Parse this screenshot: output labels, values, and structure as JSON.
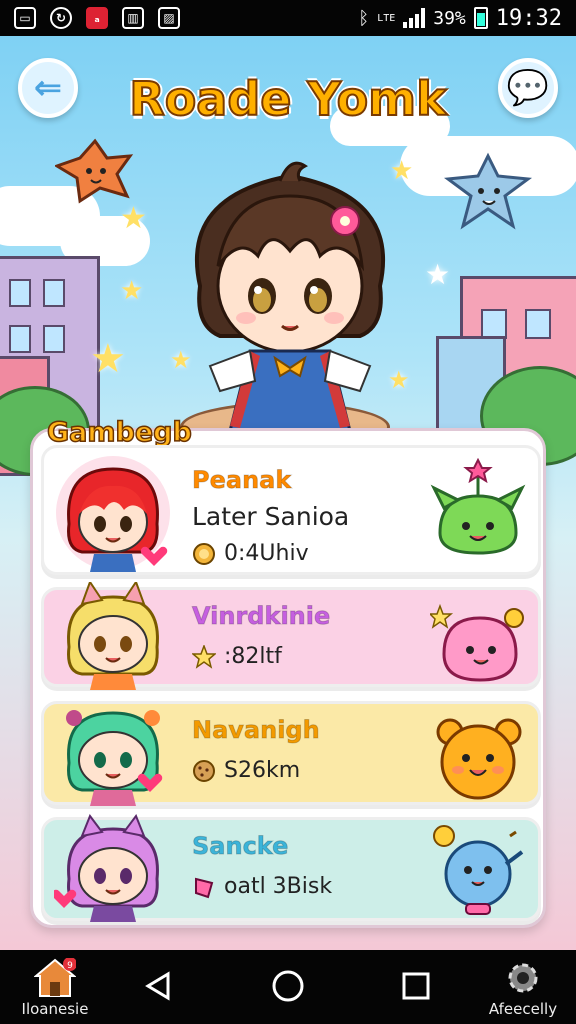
{
  "status_bar": {
    "battery_percent": "39%",
    "time": "19:32"
  },
  "header": {
    "title": "Roade Yomk",
    "back_icon": "back-arrow-icon",
    "chat_icon": "chat-bubble-icon"
  },
  "list": {
    "badge": "Gambegb",
    "items": [
      {
        "name": "Peanak",
        "subtitle": "Later Sanioa",
        "stat": "0:4Uhiv",
        "stat_icon": "coin-icon",
        "name_color": "#ff8a00",
        "bg": "#fde1ea",
        "pet": "green-slime-icon"
      },
      {
        "name": "Vinrdkinie",
        "subtitle": "",
        "stat": ":82ltf",
        "stat_icon": "star-icon",
        "name_color": "#c65fe0",
        "bg": "#fbd1e5",
        "pet": "pink-blob-icon"
      },
      {
        "name": "Navanigh",
        "subtitle": "",
        "stat": "S26km",
        "stat_icon": "cookie-icon",
        "name_color": "#f39a00",
        "bg": "#fbe9a7",
        "pet": "orange-bear-icon"
      },
      {
        "name": "Sancke",
        "subtitle": "",
        "stat": "oatl 3Bisk",
        "stat_icon": "gem-icon",
        "name_color": "#3cb4d9",
        "bg": "#cdeee8",
        "pet": "blue-bird-icon"
      }
    ]
  },
  "nav": {
    "left_label": "Iloanesie",
    "right_label": "Afeecelly",
    "home_badge": "9"
  }
}
